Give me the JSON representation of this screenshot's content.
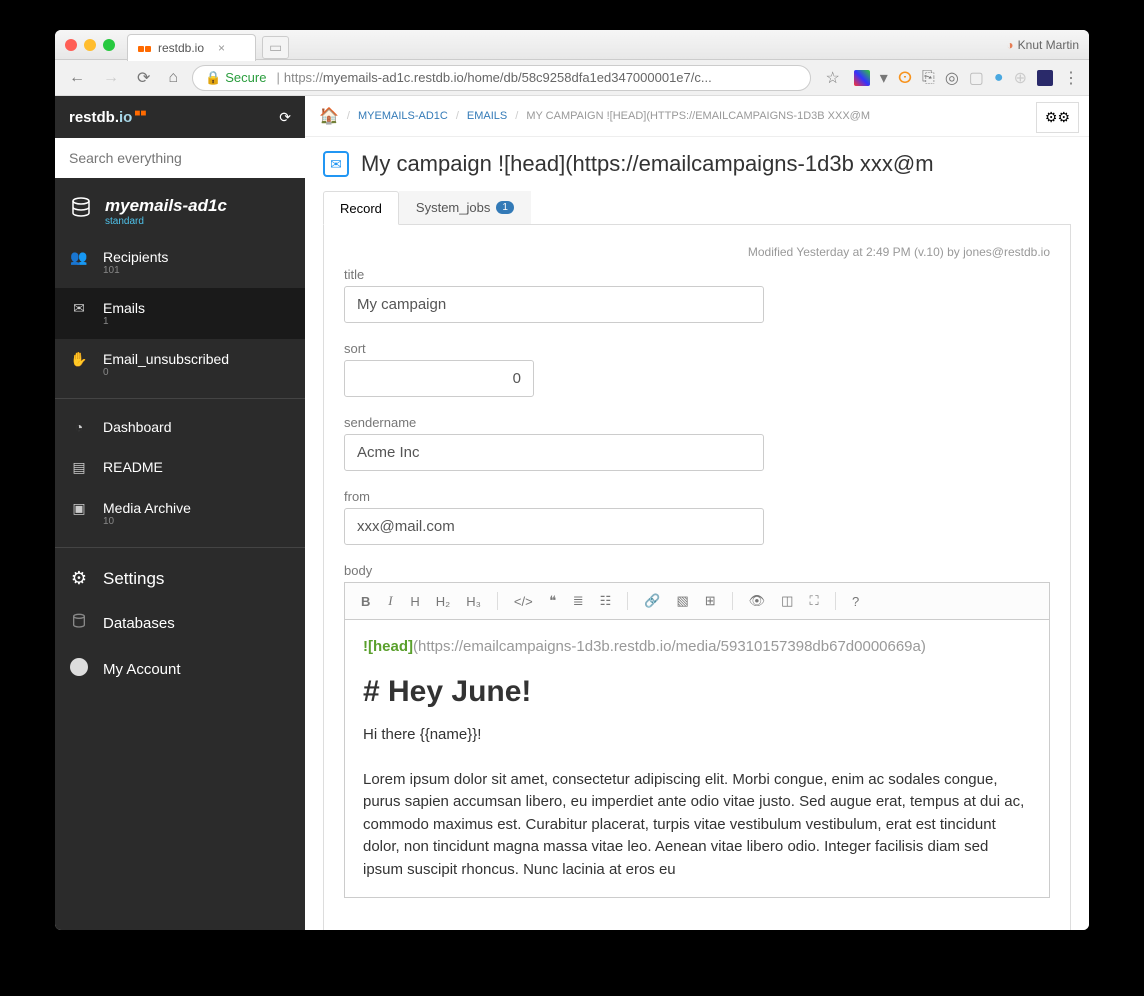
{
  "browser": {
    "tab_title": "restdb.io",
    "profile": "Knut Martin",
    "secure_label": "Secure",
    "url_prefix": "https://",
    "url": "myemails-ad1c.restdb.io/home/db/58c9258dfa1ed347000001e7/c..."
  },
  "sidebar": {
    "logo": "restdb.",
    "logo_suffix": "io",
    "search_placeholder": "Search everything",
    "db_name": "myemails-ad1c",
    "db_tier": "standard",
    "items": [
      {
        "icon": "users",
        "label": "Recipients",
        "count": "101"
      },
      {
        "icon": "mail",
        "label": "Emails",
        "count": "1"
      },
      {
        "icon": "hand",
        "label": "Email_unsubscribed",
        "count": "0"
      }
    ],
    "tools": [
      {
        "icon": "dash",
        "label": "Dashboard"
      },
      {
        "icon": "file",
        "label": "README"
      },
      {
        "icon": "image",
        "label": "Media Archive",
        "count": "10"
      }
    ],
    "bottom": [
      {
        "icon": "gear",
        "label": "Settings"
      },
      {
        "icon": "db",
        "label": "Databases"
      },
      {
        "icon": "avatar",
        "label": "My Account"
      }
    ]
  },
  "breadcrumb": {
    "items": [
      "MYEMAILS-AD1C",
      "EMAILS",
      "MY CAMPAIGN ![HEAD](HTTPS://EMAILCAMPAIGNS-1D3B XXX@M"
    ]
  },
  "page": {
    "title": "My campaign ![head](https://emailcampaigns-1d3b xxx@m",
    "tabs": [
      {
        "label": "Record"
      },
      {
        "label": "System_jobs",
        "badge": "1"
      }
    ],
    "modified": "Modified Yesterday at 2:49 PM (v.10) by jones@restdb.io",
    "fields": {
      "title_label": "title",
      "title_value": "My campaign",
      "sort_label": "sort",
      "sort_value": "0",
      "sendername_label": "sendername",
      "sendername_value": "Acme Inc",
      "from_label": "from",
      "from_value": "xxx@mail.com",
      "body_label": "body"
    },
    "editor": {
      "img_alt": "![head]",
      "img_url": "(https://emailcampaigns-1d3b.restdb.io/media/59310157398db67d0000669a)",
      "h1": "# Hey June!",
      "greeting": "Hi there {{name}}!",
      "lorem": "Lorem ipsum dolor sit amet, consectetur adipiscing elit. Morbi congue, enim ac sodales congue, purus sapien accumsan libero, eu imperdiet ante odio vitae justo. Sed augue erat, tempus at dui ac, commodo maximus est. Curabitur placerat, turpis vitae vestibulum vestibulum, erat est tincidunt dolor, non tincidunt magna massa vitae leo. Aenean vitae libero odio. Integer facilisis diam sed ipsum suscipit rhoncus. Nunc lacinia at eros eu"
    }
  }
}
